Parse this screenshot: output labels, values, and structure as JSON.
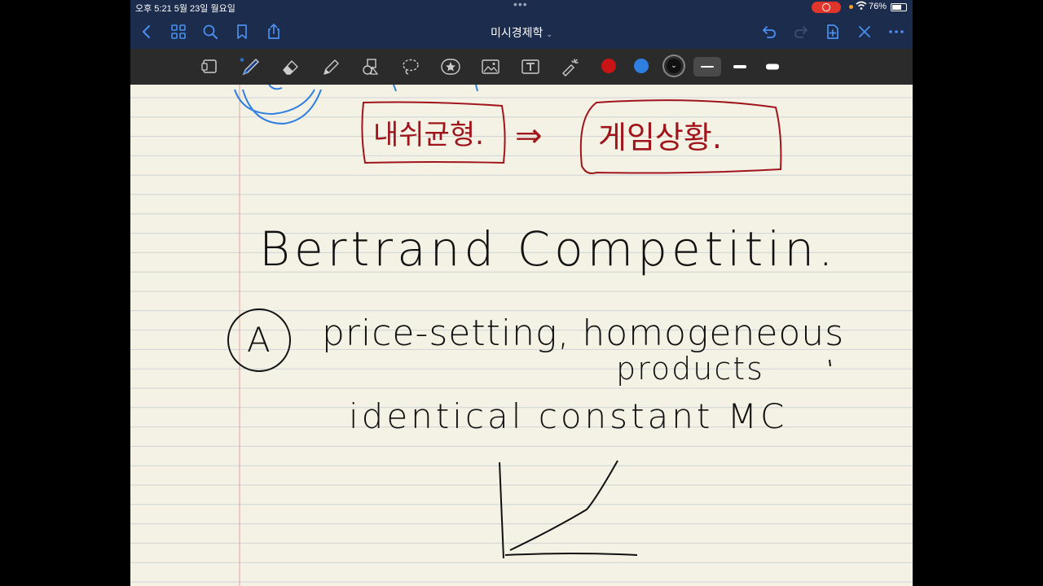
{
  "status": {
    "time": "오후 5:21   5월 23일 월요일",
    "battery_percent": "76%",
    "battery_level": 0.76
  },
  "nav": {
    "title": "미시경제학",
    "icons": [
      "back-icon",
      "grid-icon",
      "search-icon",
      "bookmark-icon",
      "share-icon",
      "undo-icon",
      "redo-icon",
      "add-page-icon",
      "close-icon",
      "more-icon"
    ]
  },
  "toolbar": {
    "tools": [
      "read-mode-icon",
      "pen-icon",
      "eraser-icon",
      "highlighter-icon",
      "shapes-icon",
      "lasso-icon",
      "sticker-icon",
      "image-icon",
      "text-icon",
      "laser-pointer-icon"
    ],
    "colors": [
      "#c81414",
      "#2f7fe0",
      "#111111"
    ],
    "selected_color": "#111111",
    "thickness_levels": [
      "thin",
      "medium",
      "thick"
    ],
    "selected_thickness": "thin"
  },
  "note": {
    "korean_box_left": "내쉬균형.",
    "arrow": "⇒",
    "korean_box_right": "게임상황.",
    "heading": "Bertrand Competitin.",
    "item_marker": "A",
    "line1": "price-setting, homogeneous",
    "line2": "products",
    "line3": "identical constant MC",
    "ink_colors": {
      "red": "#a0151c",
      "black": "#111111",
      "blue": "#2f7fe0"
    }
  }
}
